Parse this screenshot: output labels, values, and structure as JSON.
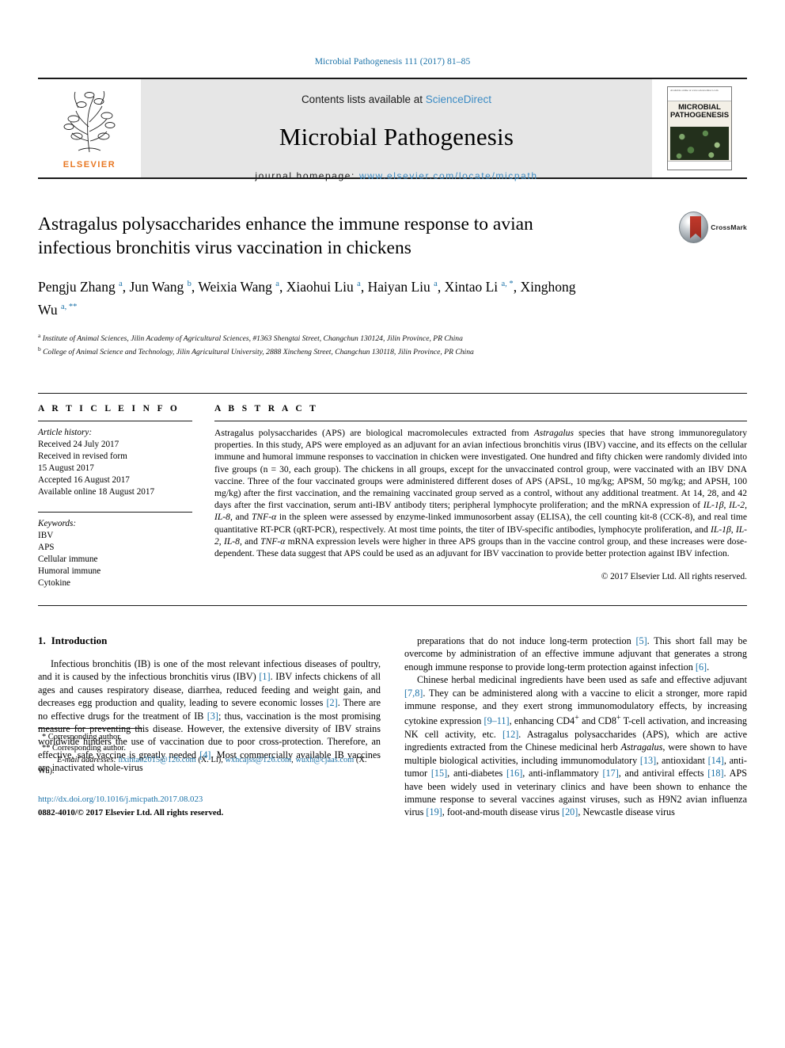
{
  "running_head": "Microbial Pathogenesis 111 (2017) 81–85",
  "masthead": {
    "contents_prefix": "Contents lists available at ",
    "sciencedirect": "ScienceDirect",
    "journal_name": "Microbial Pathogenesis",
    "homepage_label": "journal homepage: ",
    "homepage_url": "www.elsevier.com/locate/micpath",
    "publisher_logo_text": "ELSEVIER",
    "cover_title": "MICROBIAL PATHOGENESIS",
    "cover_topband_text": "Available online at www.sciencedirect.com"
  },
  "article": {
    "title": "Astragalus polysaccharides enhance the immune response to avian infectious bronchitis virus vaccination in chickens",
    "crossmark_label": "CrossMark",
    "authors_html": "Pengju Zhang <sup>a</sup>, Jun Wang <sup>b</sup>, Weixia Wang <sup>a</sup>, Xiaohui Liu <sup>a</sup>, Haiyan Liu <sup>a</sup>, Xintao Li <sup>a, *</sup>, Xinghong Wu <sup>a, **</sup>",
    "affiliations": [
      "Institute of Animal Sciences, Jilin Academy of Agricultural Sciences, #1363 Shengtai Street, Changchun 130124, Jilin Province, PR China",
      "College of Animal Science and Technology, Jilin Agricultural University, 2888 Xincheng Street, Changchun 130118, Jilin Province, PR China"
    ],
    "affiliation_marks": [
      "a",
      "b"
    ]
  },
  "article_info": {
    "heading": "A R T I C L E   I N F O",
    "history_label": "Article history:",
    "history": [
      "Received 24 July 2017",
      "Received in revised form",
      "15 August 2017",
      "Accepted 16 August 2017",
      "Available online 18 August 2017"
    ],
    "keywords_label": "Keywords:",
    "keywords": [
      "IBV",
      "APS",
      "Cellular immune",
      "Humoral immune",
      "Cytokine"
    ]
  },
  "abstract": {
    "heading": "A B S T R A C T",
    "text_html": "Astragalus polysaccharides (APS) are biological macromolecules extracted from <i>Astragalus</i> species that have strong immunoregulatory properties. In this study, APS were employed as an adjuvant for an avian infectious bronchitis virus (IBV) vaccine, and its effects on the cellular immune and humoral immune responses to vaccination in chicken were investigated. One hundred and fifty chicken were randomly divided into five groups (n = 30, each group). The chickens in all groups, except for the unvaccinated control group, were vaccinated with an IBV DNA vaccine. Three of the four vaccinated groups were administered different doses of APS (APSL, 10 mg/kg; APSM, 50 mg/kg; and APSH, 100 mg/kg) after the first vaccination, and the remaining vaccinated group served as a control, without any additional treatment. At 14, 28, and 42 days after the first vaccination, serum anti-IBV antibody titers; peripheral lymphocyte proliferation; and the mRNA expression of <i>IL-1β</i>, <i>IL-2</i>, <i>IL-8</i>, and <i>TNF-α</i> in the spleen were assessed by enzyme-linked immunosorbent assay (ELISA), the cell counting kit-8 (CCK-8), and real time quantitative RT-PCR (qRT-PCR), respectively. At most time points, the titer of IBV-specific antibodies, lymphocyte proliferation, and <i>IL-1β</i>, <i>IL-2</i>, <i>IL-8</i>, and <i>TNF-α</i> mRNA expression levels were higher in three APS groups than in the vaccine control group, and these increases were dose-dependent. These data suggest that APS could be used as an adjuvant for IBV vaccination to provide better protection against IBV infection.",
    "copyright": "© 2017 Elsevier Ltd. All rights reserved."
  },
  "introduction": {
    "number": "1.",
    "title": "Introduction",
    "left_paragraph_html": "Infectious bronchitis (IB) is one of the most relevant infectious diseases of poultry, and it is caused by the infectious bronchitis virus (IBV) <span class=\"ref\">[1]</span>. IBV infects chickens of all ages and causes respiratory disease, diarrhea, reduced feeding and weight gain, and decreases egg production and quality, leading to severe economic losses <span class=\"ref\">[2]</span>. There are no effective drugs for the treatment of IB <span class=\"ref\">[3]</span>; thus, vaccination is the most promising measure for preventing this disease. However, the extensive diversity of IBV strains worldwide hinders the use of vaccination due to poor cross-protection. Therefore, an effective, safe vaccine is greatly needed <span class=\"ref\">[4]</span>. Most commercially available IB vaccines are inactivated whole-virus",
    "right_paragraph_1_html": "preparations that do not induce long-term protection <span class=\"ref\">[5]</span>. This short fall may be overcome by administration of an effective immune adjuvant that generates a strong enough immune response to provide long-term protection against infection <span class=\"ref\">[6]</span>.",
    "right_paragraph_2_html": "Chinese herbal medicinal ingredients have been used as safe and effective adjuvant <span class=\"ref\">[7,8]</span>. They can be administered along with a vaccine to elicit a stronger, more rapid immune response, and they exert strong immunomodulatory effects, by increasing cytokine expression <span class=\"ref\">[9–11]</span>, enhancing CD4<sup>+</sup> and CD8<sup>+</sup> T-cell activation, and increasing NK cell activity, etc. <span class=\"ref\">[12]</span>. Astragalus polysaccharides (APS), which are active ingredients extracted from the Chinese medicinal herb <i>Astragalus</i>, were shown to have multiple biological activities, including immunomodulatory <span class=\"ref\">[13]</span>, antioxidant <span class=\"ref\">[14]</span>, anti-tumor <span class=\"ref\">[15]</span>, anti-diabetes <span class=\"ref\">[16]</span>, anti-inflammatory <span class=\"ref\">[17]</span>, and antiviral effects <span class=\"ref\">[18]</span>. APS have been widely used in veterinary clinics and have been shown to enhance the immune response to several vaccines against viruses, such as H9N2 avian influenza virus <span class=\"ref\">[19]</span>, foot-and-mouth disease virus <span class=\"ref\">[20]</span>, Newcastle disease virus"
  },
  "footnotes": {
    "corresponding_1": "* Corresponding author.",
    "corresponding_2": "** Corresponding author.",
    "email_label": "E-mail addresses:",
    "email_1": "lixintao2015@126.com",
    "email_1_who": "(X. Li)",
    "email_2": "wxhcajss@126.com",
    "email_3": "wuxh@cjaas.com",
    "email_3_who": "(X. Wu)",
    "doi": "http://dx.doi.org/10.1016/j.micpath.2017.08.023",
    "issn_line": "0882-4010/© 2017 Elsevier Ltd. All rights reserved."
  },
  "colors": {
    "link": "#1b72a8",
    "sciencedirect": "#3b8bc4",
    "elsevier_orange": "#e87722",
    "masthead_bg": "#e6e6e6"
  }
}
